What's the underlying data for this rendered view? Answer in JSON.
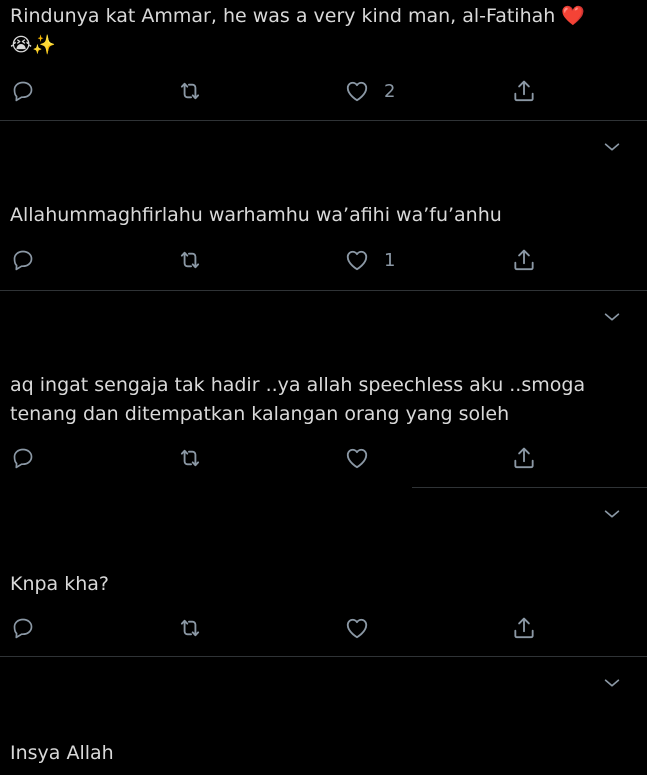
{
  "tweets": [
    {
      "text": "Rindunya kat Ammar, he was a very kind man, al-Fatihah",
      "emoji_inline": "❤️",
      "emoji_line2": "😭✨",
      "likes": "2",
      "replies": "",
      "retweets": ""
    },
    {
      "text": "Allahummaghfirlahu warhamhu wa’afihi wa’fu’anhu",
      "likes": "1",
      "replies": "",
      "retweets": ""
    },
    {
      "text_line1": "aq ingat sengaja tak hadir ..ya allah speechless aku ..smoga",
      "text_line2": "tenang dan ditempatkan kalangan orang yang soleh",
      "likes": "",
      "replies": "",
      "retweets": ""
    },
    {
      "text": "Knpa kha?",
      "likes": "",
      "replies": "",
      "retweets": ""
    },
    {
      "text": "Insya Allah",
      "likes": "",
      "replies": "",
      "retweets": ""
    }
  ],
  "colors": {
    "background": "#000000",
    "text": "#d9d9d9",
    "icon": "#8b98a5",
    "divider": "#2f3336",
    "heart_emoji": "#e0245e"
  },
  "icons": [
    "reply-icon",
    "retweet-icon",
    "like-icon",
    "share-icon",
    "chevron-down-icon"
  ]
}
